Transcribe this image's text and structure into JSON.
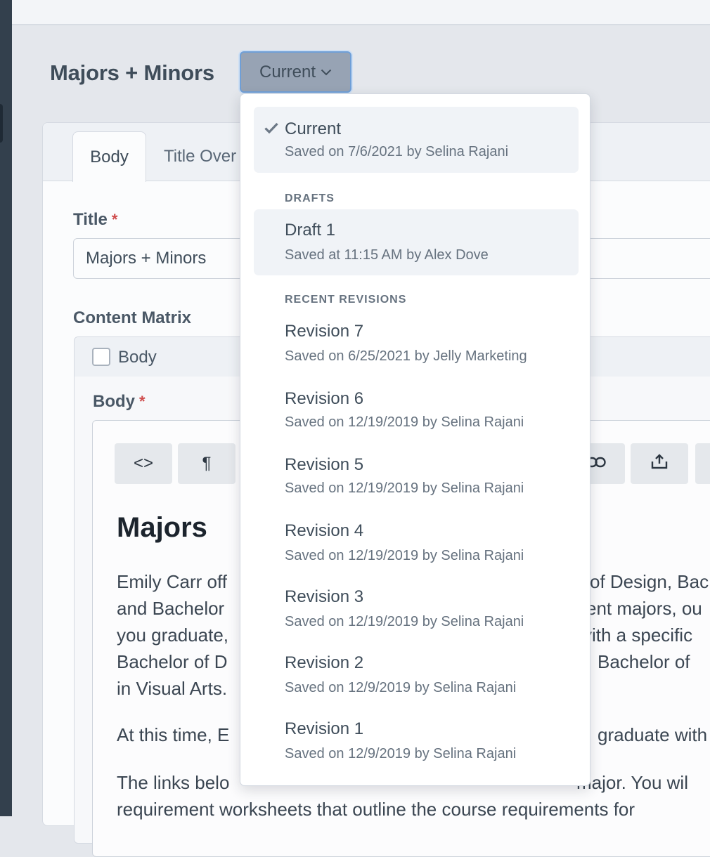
{
  "page": {
    "heading": "Majors + Minors",
    "revision_button": "Current"
  },
  "tabs": [
    {
      "label": "Body"
    },
    {
      "label": "Title Over"
    }
  ],
  "form": {
    "title_label": "Title",
    "title_value": "Majors + Minors",
    "required_mark": "*",
    "content_matrix_label": "Content Matrix",
    "matrix_block_title": "Body",
    "body_label": "Body"
  },
  "editor": {
    "toolbar": {
      "html_glyph": "<>",
      "paragraph_glyph": "¶"
    },
    "heading": "Majors",
    "lines_left": [
      "Emily Carr off",
      "and Bachelor",
      "you graduate,",
      "Bachelor of D",
      "in Visual Arts."
    ],
    "lines_right": [
      "of Design, Bac",
      "ent majors, ou",
      "vith a specific",
      "Bachelor of",
      ""
    ],
    "para2_left": "At this time, E",
    "para2_right": "graduate with",
    "para3_line1": "The links belo",
    "para3_line1_right": "major. You wil",
    "para3_line2": "requirement worksheets that outline the course requirements for"
  },
  "dropdown": {
    "current": {
      "label": "Current",
      "meta": "Saved on 7/6/2021 by Selina Rajani"
    },
    "drafts_heading": "DRAFTS",
    "drafts": [
      {
        "label": "Draft 1",
        "meta": "Saved at 11:15 AM by Alex Dove"
      }
    ],
    "revisions_heading": "RECENT REVISIONS",
    "revisions": [
      {
        "label": "Revision 7",
        "meta": "Saved on 6/25/2021 by Jelly Marketing"
      },
      {
        "label": "Revision 6",
        "meta": "Saved on 12/19/2019 by Selina Rajani"
      },
      {
        "label": "Revision 5",
        "meta": "Saved on 12/19/2019 by Selina Rajani"
      },
      {
        "label": "Revision 4",
        "meta": "Saved on 12/19/2019 by Selina Rajani"
      },
      {
        "label": "Revision 3",
        "meta": "Saved on 12/19/2019 by Selina Rajani"
      },
      {
        "label": "Revision 2",
        "meta": "Saved on 12/9/2019 by Selina Rajani"
      },
      {
        "label": "Revision 1",
        "meta": "Saved on 12/9/2019 by Selina Rajani"
      }
    ]
  },
  "colors": {
    "sidebar": "#33404d",
    "button_bg": "#97a3b4",
    "focus_ring": "#6f9fd7",
    "required": "#cf4b4b",
    "highlight": "#f0f3f7"
  },
  "icons": [
    "chevron-down-icon",
    "checkmark-icon",
    "html-source-icon",
    "paragraph-icon",
    "link-icon",
    "share-icon"
  ]
}
